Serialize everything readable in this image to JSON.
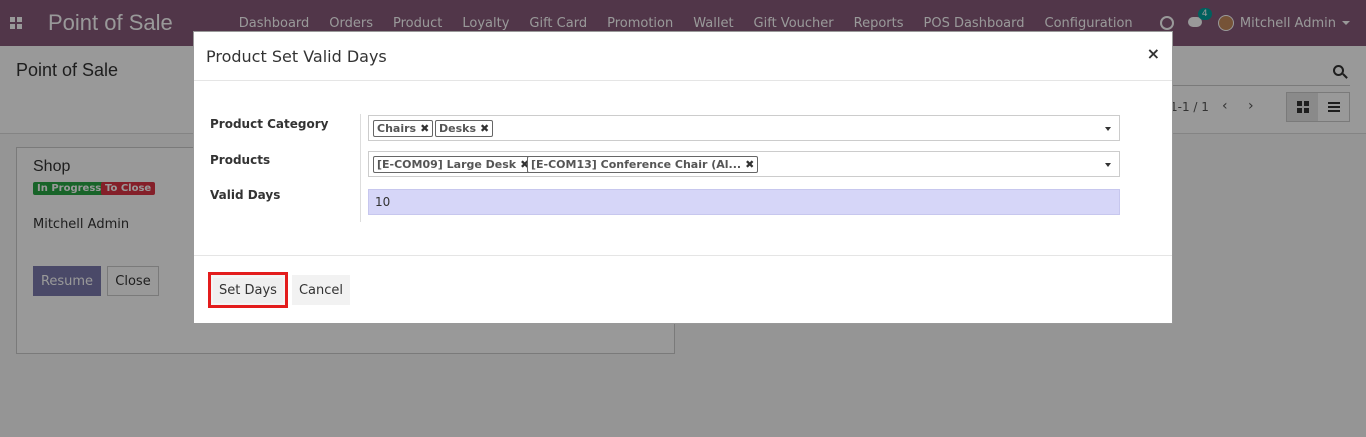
{
  "navbar": {
    "brand": "Point of Sale",
    "menu": [
      "Dashboard",
      "Orders",
      "Product",
      "Loyalty",
      "Gift Card",
      "Promotion",
      "Wallet",
      "Gift Voucher",
      "Reports",
      "POS Dashboard",
      "Configuration"
    ],
    "chat_count": "4",
    "user_name": "Mitchell Admin"
  },
  "control_panel": {
    "breadcrumb": "Point of Sale",
    "pager": "1-1 / 1"
  },
  "card": {
    "title": "Shop",
    "badge_in_progress": "In Progress",
    "badge_to_close": "To Close",
    "user": "Mitchell Admin",
    "resume_label": "Resume",
    "close_label": "Close"
  },
  "modal": {
    "title": "Product Set Valid Days",
    "close_glyph": "×",
    "labels": {
      "product_category": "Product Category",
      "products": "Products",
      "valid_days": "Valid Days"
    },
    "category_tags": [
      "Chairs",
      "Desks"
    ],
    "product_tags": [
      "[E-COM09] Large Desk",
      "[E-COM13] Conference Chair (Al..."
    ],
    "valid_days_value": "10",
    "set_days_label": "Set Days",
    "cancel_label": "Cancel"
  },
  "colors": {
    "navbar": "#875a7b",
    "primary_button": "#7c7bad",
    "highlight_border": "#e31c1c",
    "valid_days_bg": "#d6d6f8"
  }
}
